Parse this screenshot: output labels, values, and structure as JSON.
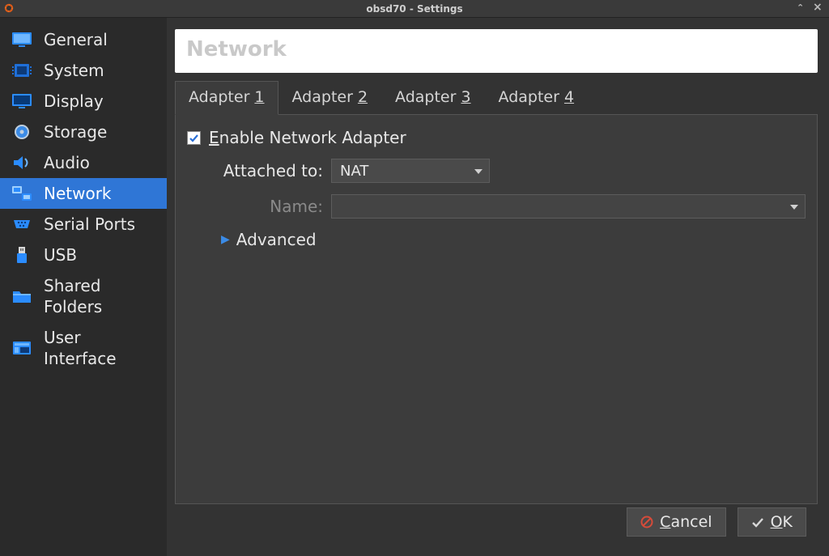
{
  "window": {
    "title": "obsd70 - Settings"
  },
  "sidebar": {
    "items": [
      {
        "label": "General"
      },
      {
        "label": "System"
      },
      {
        "label": "Display"
      },
      {
        "label": "Storage"
      },
      {
        "label": "Audio"
      },
      {
        "label": "Network"
      },
      {
        "label": "Serial Ports"
      },
      {
        "label": "USB"
      },
      {
        "label": "Shared Folders"
      },
      {
        "label": "User Interface"
      }
    ],
    "active_index": 5
  },
  "header": {
    "title": "Network"
  },
  "tabs": [
    {
      "prefix": "Adapter ",
      "key": "1"
    },
    {
      "prefix": "Adapter ",
      "key": "2"
    },
    {
      "prefix": "Adapter ",
      "key": "3"
    },
    {
      "prefix": "Adapter ",
      "key": "4"
    }
  ],
  "panel": {
    "enable_prefix": "E",
    "enable_rest": "nable Network Adapter",
    "enable_checked": true,
    "attached_prefix": "A",
    "attached_rest": "ttached to:",
    "attached_value": "NAT",
    "name_prefix": "N",
    "name_rest": "ame:",
    "name_value": "",
    "advanced_prefix": "A",
    "advanced_rest": "dvanced"
  },
  "footer": {
    "cancel_prefix": "C",
    "cancel_rest": "ancel",
    "ok_prefix": "O",
    "ok_rest": "K"
  }
}
